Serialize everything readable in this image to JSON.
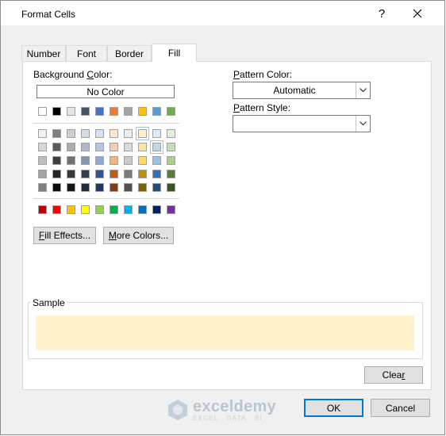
{
  "window": {
    "title": "Format Cells",
    "help": "?",
    "close": "✕"
  },
  "tabs": [
    {
      "label": "Number"
    },
    {
      "label": "Font"
    },
    {
      "label": "Border"
    },
    {
      "label": "Fill",
      "active": true
    }
  ],
  "background": {
    "label_pre": "Background ",
    "label_u": "C",
    "label_post": "olor:",
    "no_color": "No Color",
    "selected": "#fff2cc",
    "theme_row": [
      "#ffffff",
      "#000000",
      "#e7e6e6",
      "#44546a",
      "#4472c4",
      "#ed7d31",
      "#a5a5a5",
      "#ffc000",
      "#5b9bd5",
      "#70ad47"
    ],
    "shades": [
      [
        "#f2f2f2",
        "#7f7f7f",
        "#d0cece",
        "#d6dce4",
        "#d9e2f3",
        "#fbe5d5",
        "#ededed",
        "#fff2cc",
        "#deebf6",
        "#e2efd9"
      ],
      [
        "#d8d8d8",
        "#595959",
        "#aeabab",
        "#adb9ca",
        "#b4c6e7",
        "#f7cbac",
        "#dbdbdb",
        "#fee599",
        "#bdd7ee",
        "#c5e0b3"
      ],
      [
        "#bfbfbf",
        "#3f3f3f",
        "#757070",
        "#8496b0",
        "#8eaadb",
        "#f4b183",
        "#c9c9c9",
        "#ffd965",
        "#9cc3e5",
        "#a8d08d"
      ],
      [
        "#a5a5a5",
        "#262626",
        "#3a3838",
        "#323f4f",
        "#2f5496",
        "#c55a11",
        "#7b7b7b",
        "#bf9000",
        "#2e75b5",
        "#538135"
      ],
      [
        "#7f7f7f",
        "#0c0c0c",
        "#171616",
        "#222a35",
        "#1f3864",
        "#833c0b",
        "#525252",
        "#7f6000",
        "#1e4e79",
        "#375623"
      ]
    ],
    "standard_row": [
      "#c00000",
      "#ff0000",
      "#ffc000",
      "#ffff00",
      "#92d050",
      "#00b050",
      "#00b0f0",
      "#0070c0",
      "#002060",
      "#7030a0"
    ],
    "fill_effects": {
      "u": "F",
      "rest": "ill Effects..."
    },
    "more_colors": {
      "u": "M",
      "rest": "ore Colors..."
    }
  },
  "pattern": {
    "color_label": {
      "u": "P",
      "rest": "attern Color:"
    },
    "color_value": "Automatic",
    "style_label": {
      "u": "P",
      "rest": "attern Style:"
    },
    "style_value": ""
  },
  "sample": {
    "label": "Sample",
    "color": "#fff2cc"
  },
  "buttons": {
    "clear": {
      "pre": "Clea",
      "u": "r"
    },
    "ok": "OK",
    "cancel": "Cancel"
  },
  "watermark": {
    "name": "exceldemy",
    "sub": "EXCEL · DATA · BI"
  }
}
